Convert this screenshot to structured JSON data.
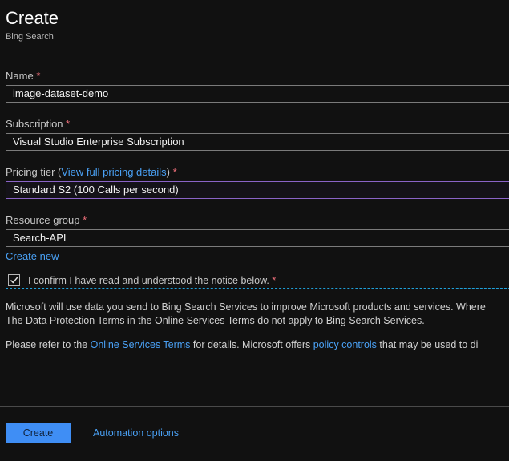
{
  "header": {
    "title": "Create",
    "subtitle": "Bing Search"
  },
  "form": {
    "name": {
      "label": "Name",
      "required": "*",
      "value": "image-dataset-demo"
    },
    "subscription": {
      "label": "Subscription",
      "required": "*",
      "value": "Visual Studio Enterprise Subscription"
    },
    "pricing": {
      "label_prefix": "Pricing tier (",
      "label_link": "View full pricing details",
      "label_suffix": ")",
      "required": "*",
      "value": "Standard S2 (100 Calls per second)"
    },
    "resource_group": {
      "label": "Resource group",
      "required": "*",
      "value": "Search-API",
      "create_new": "Create new"
    },
    "confirm": {
      "label": "I confirm I have read and understood the notice below.",
      "required": "*",
      "checked": true
    }
  },
  "notice": {
    "line1": "Microsoft will use data you send to Bing Search Services to improve Microsoft products and services. Where",
    "line2": "The Data Protection Terms in the Online Services Terms do not apply to Bing Search Services.",
    "line3_prefix": "Please refer to the ",
    "line3_link1": "Online Services Terms",
    "line3_mid": " for details. Microsoft offers ",
    "line3_link2": "policy controls",
    "line3_suffix": " that may be used to di"
  },
  "footer": {
    "create_button": "Create",
    "automation_link": "Automation options"
  },
  "colors": {
    "background": "#111111",
    "accent": "#3f8ef5",
    "link": "#4aa1f5",
    "required": "#f1707b",
    "focus_border": "#1f9fd8"
  }
}
